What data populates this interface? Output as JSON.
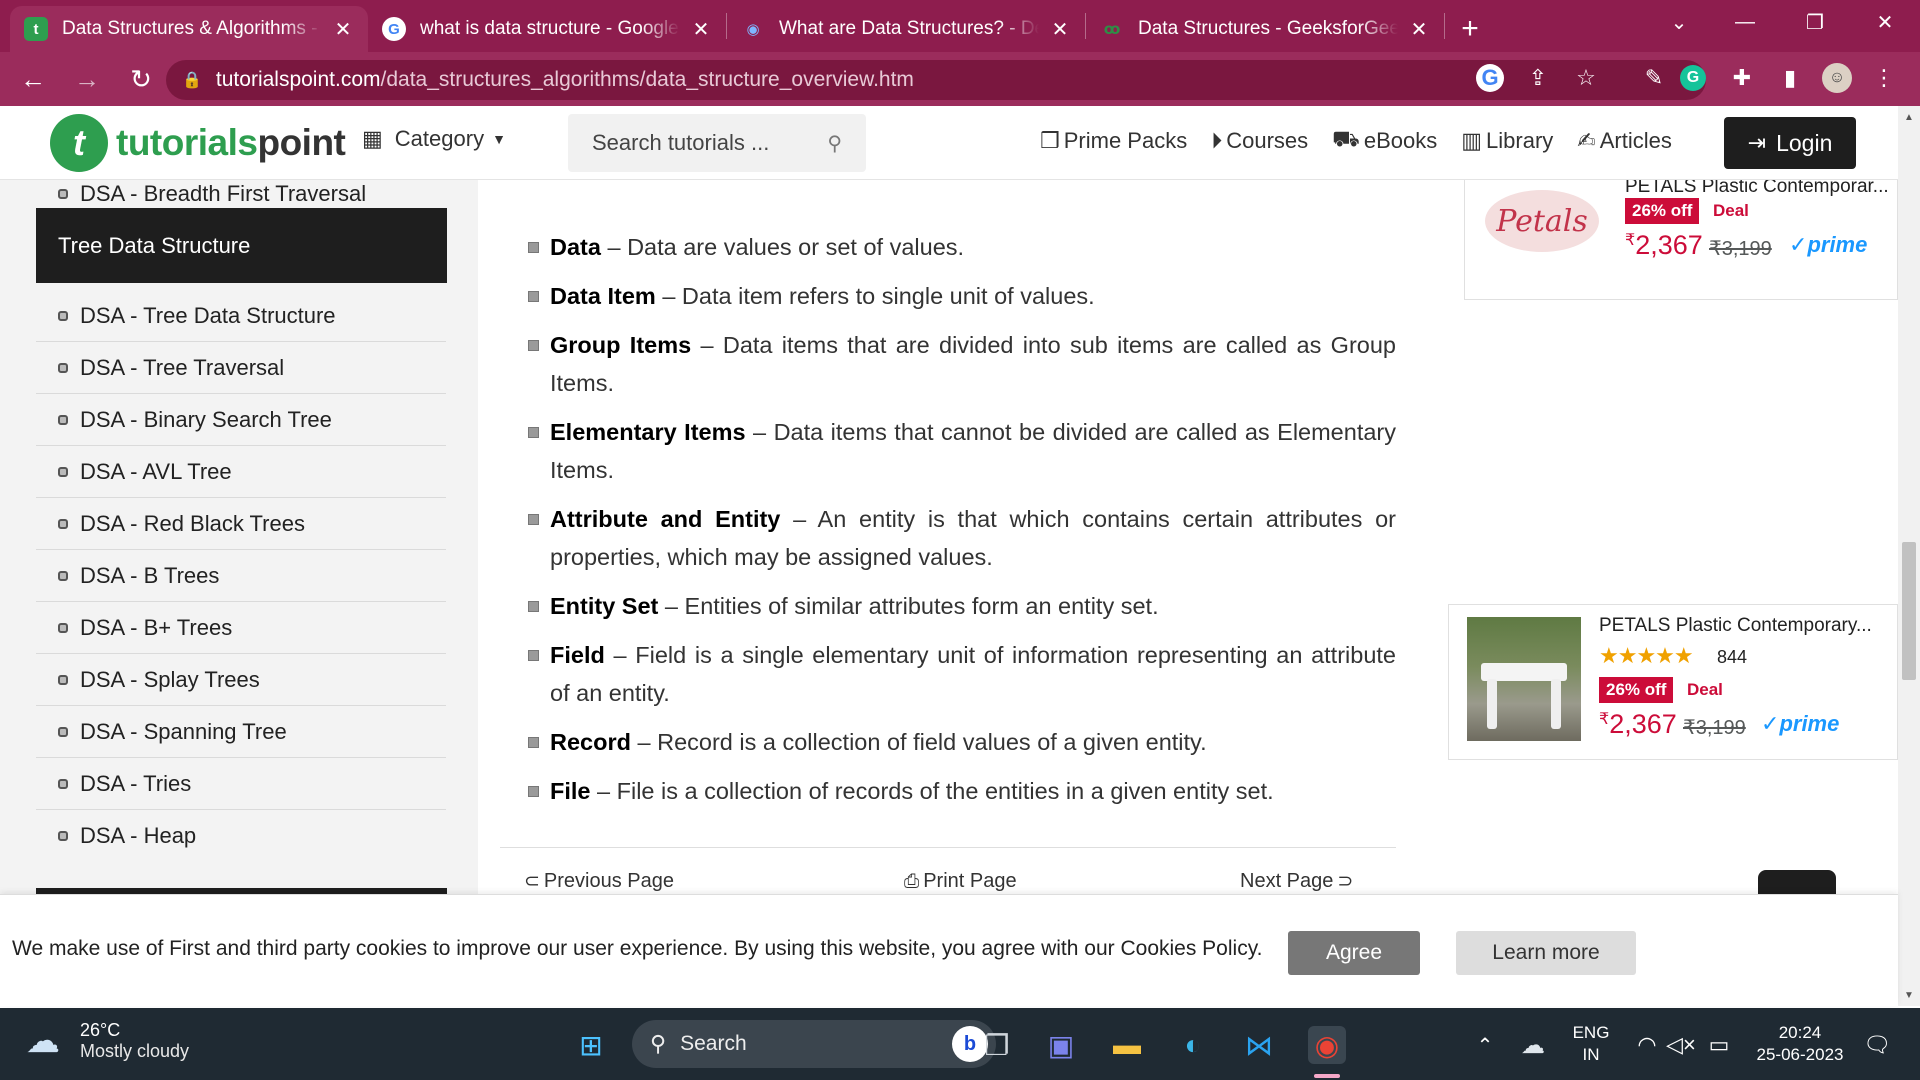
{
  "browser": {
    "tabs": [
      {
        "title": "Data Structures & Algorithms - O",
        "favicon": "tp-favicon",
        "active": true
      },
      {
        "title": "what is data structure - Google S",
        "favicon": "google-favicon",
        "active": false
      },
      {
        "title": "What are Data Structures? - Defir",
        "favicon": "eye-favicon",
        "active": false
      },
      {
        "title": "Data Structures - GeeksforGeeks",
        "favicon": "gfg-favicon",
        "active": false
      }
    ],
    "url_host": "tutorialspoint.com",
    "url_path": "/data_structures_algorithms/data_structure_overview.htm",
    "theme_color": "#8e1d4e"
  },
  "site": {
    "logo_part1": "tutorials",
    "logo_part2": "point",
    "category_label": "Category",
    "search_placeholder": "Search tutorials ...",
    "nav": [
      "Prime Packs",
      "Courses",
      "eBooks",
      "Library",
      "Articles"
    ],
    "login_label": "Login",
    "brand_color": "#2e9e4f"
  },
  "sidebar": {
    "top_item": "DSA - Breadth First Traversal",
    "heading": "Tree Data Structure",
    "items": [
      "DSA - Tree Data Structure",
      "DSA - Tree Traversal",
      "DSA - Binary Search Tree",
      "DSA - AVL Tree",
      "DSA - Red Black Trees",
      "DSA - B Trees",
      "DSA - B+ Trees",
      "DSA - Splay Trees",
      "DSA - Spanning Tree",
      "DSA - Tries",
      "DSA - Heap"
    ]
  },
  "content": {
    "definitions": [
      {
        "term": "Data",
        "text": " – Data are values or set of values."
      },
      {
        "term": "Data Item",
        "text": " – Data item refers to single unit of values."
      },
      {
        "term": "Group Items",
        "text": " – Data items that are divided into sub items are called as Group Items."
      },
      {
        "term": "Elementary Items",
        "text": " – Data items that cannot be divided are called as Elementary Items."
      },
      {
        "term": "Attribute and Entity",
        "text": " – An entity is that which contains certain attributes or properties, which may be assigned values."
      },
      {
        "term": "Entity Set",
        "text": " – Entities of similar attributes form an entity set."
      },
      {
        "term": "Field",
        "text": " – Field is a single elementary unit of information representing an attribute of an entity."
      },
      {
        "term": "Record",
        "text": " – Record is a collection of field values of a given entity."
      },
      {
        "term": "File",
        "text": " – File is a collection of records of the entities in a given entity set."
      }
    ],
    "pager": {
      "prev": "Previous Page",
      "print": "Print Page",
      "next": "Next Page"
    }
  },
  "ads": {
    "ad1": {
      "title": "PETALS Plastic Contemporar...",
      "logo": "Petals",
      "discount": "26% off",
      "deal": "Deal",
      "price": "2,367",
      "mrp": "₹3,199",
      "prime": "prime",
      "currency": "₹"
    },
    "ad2": {
      "title": "PETALS Plastic Contemporary...",
      "stars": "★★★★★",
      "rating_count": "844",
      "discount": "26% off",
      "deal": "Deal",
      "price": "2,367",
      "mrp": "₹3,199",
      "prime": "prime",
      "currency": "₹"
    }
  },
  "cookie": {
    "text": "We make use of First and third party cookies to improve our user experience. By using this website, you agree with our Cookies Policy.",
    "agree": "Agree",
    "learn_more": "Learn more"
  },
  "taskbar": {
    "temp": "26°C",
    "weather": "Mostly cloudy",
    "search_label": "Search",
    "lang_top": "ENG",
    "lang_bottom": "IN",
    "time": "20:24",
    "date": "25-06-2023"
  }
}
